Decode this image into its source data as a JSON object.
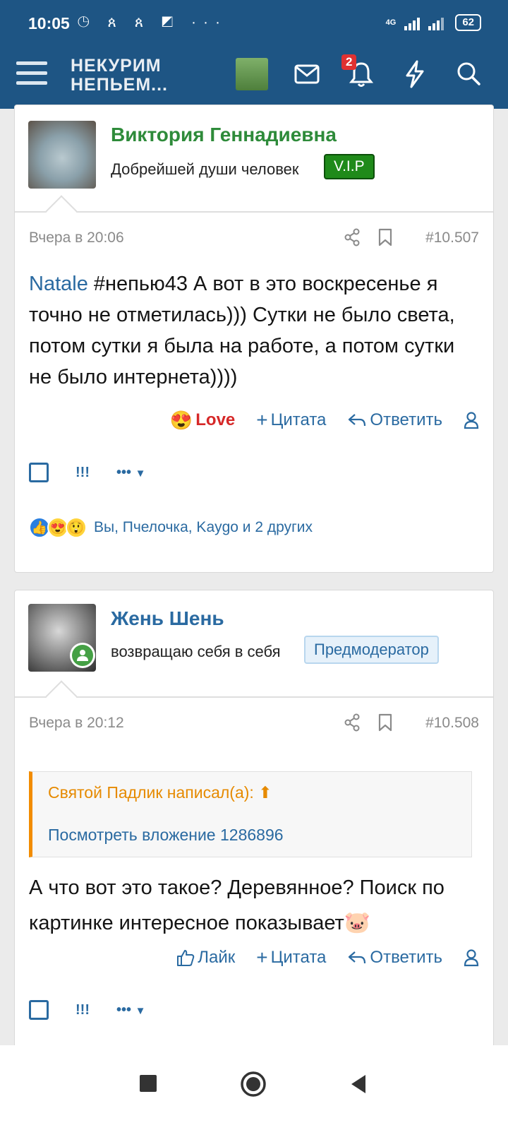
{
  "status_bar": {
    "time": "10:05",
    "battery": "62",
    "network": "4G"
  },
  "header": {
    "logo_line1": "НЕКУРИМ",
    "logo_line2": "НЕПЬЕМ...",
    "notifications_count": "2"
  },
  "posts": [
    {
      "author": "Виктория Геннадиевна",
      "user_title": "Добрейшей души человек",
      "badge": "V.I.P",
      "author_color": "#2e8b3a",
      "date": "Вчера в 20:06",
      "number": "#10.507",
      "mention": "Natale",
      "text": " #непью43 А вот в это воскресенье я точно не отметилась))) Сутки не было света, потом сутки я была на работе, а потом сутки не было интернета))))",
      "reaction_label": "Love",
      "quote_label": "Цитата",
      "reply_label": "Ответить",
      "reactions_summary": "Вы, Пчелочка, Kaygo и 2 других"
    },
    {
      "author": "Жень Шень",
      "user_title": "возвращаю себя в себя",
      "badge": "Предмодератор",
      "author_color": "#2a6aa1",
      "date": "Вчера в 20:12",
      "number": "#10.508",
      "quote_author": "Святой Падлик написал(а):",
      "quote_link": "Посмотреть вложение 1286896",
      "text": "А что вот это такое? Деревянное? Поиск по картинке интересное показывает",
      "like_label": "Лайк",
      "quote_label": "Цитата",
      "reply_label": "Ответить"
    }
  ],
  "tools": {
    "exclaim": "!!!",
    "more": "•••"
  },
  "colors": {
    "header_bg": "#1e5584",
    "link": "#2a6aa1",
    "love": "#d62828",
    "vip": "#1f8a1a",
    "quote_bar": "#f28c00"
  }
}
